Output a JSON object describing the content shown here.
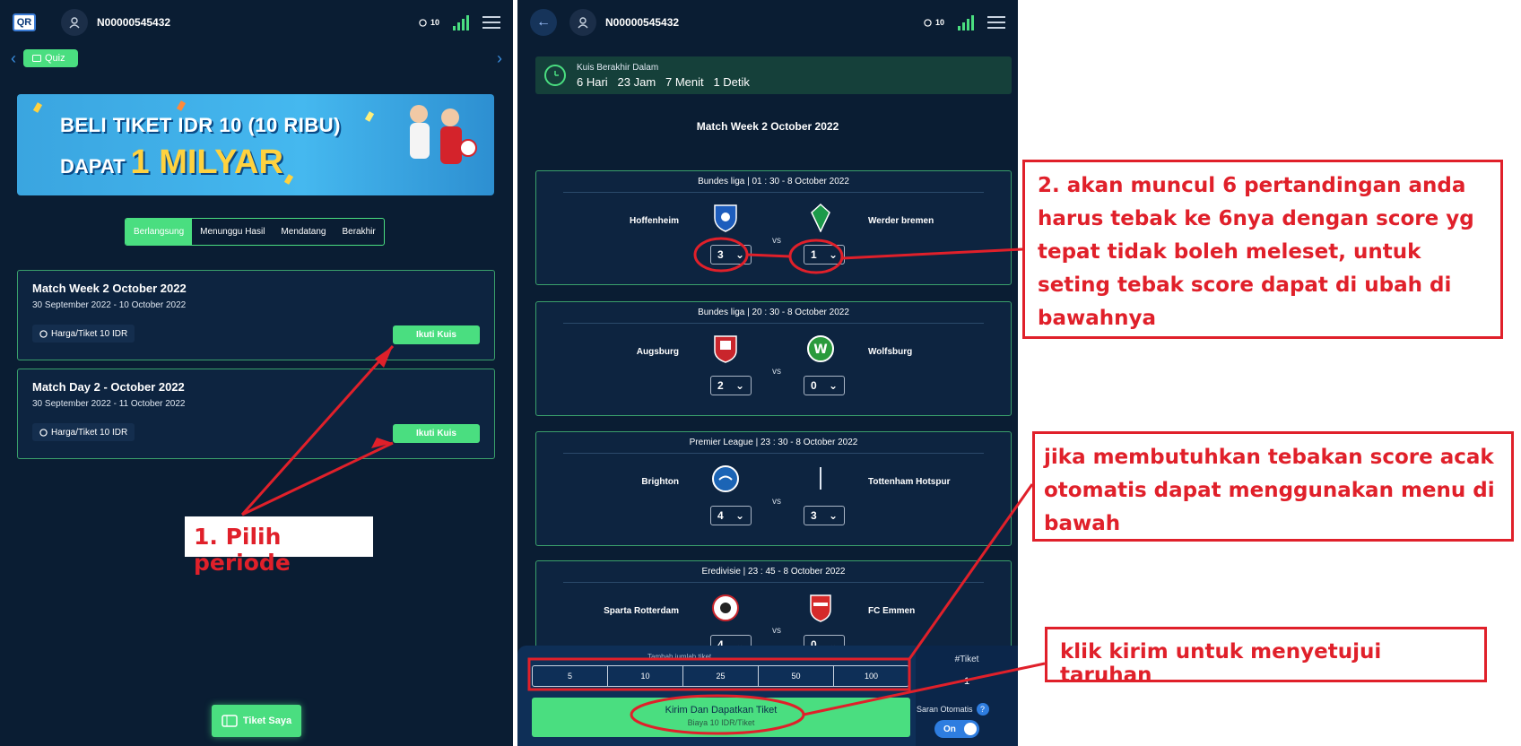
{
  "left_app": {
    "logo": "QR",
    "username": "N00000545432",
    "coins": "10",
    "quiz_tab": "Quiz",
    "banner": {
      "line1": "BELI TIKET IDR 10 (10 RIBU)",
      "line2_prefix": "DAPAT",
      "line2_big": "1 MILYAR"
    },
    "tabs": [
      "Berlangsung",
      "Menunggu Hasil",
      "Mendatang",
      "Berakhir"
    ],
    "periods": [
      {
        "title": "Match Week 2 October 2022",
        "dates": "30 September 2022 - 10 October 2022",
        "price": "Harga/Tiket 10 IDR",
        "button": "Ikuti Kuis"
      },
      {
        "title": "Match Day 2 - October 2022",
        "dates": "30 September 2022 - 11 October 2022",
        "price": "Harga/Tiket 10 IDR",
        "button": "Ikuti Kuis"
      }
    ],
    "ticket_button": "Tiket Saya"
  },
  "right_app": {
    "username": "N00000545432",
    "coins": "10",
    "countdown_label": "Kuis Berakhir Dalam",
    "countdown_value": "6 Hari   23 Jam   7 Menit   1 Detik",
    "week_title": "Match Week 2 October 2022",
    "vs": "vs",
    "matches": [
      {
        "header": "Bundes liga | 01 : 30 - 8 October 2022",
        "home": "Hoffenheim",
        "away": "Werder bremen",
        "home_score": "3",
        "away_score": "1"
      },
      {
        "header": "Bundes liga | 20 : 30 - 8 October 2022",
        "home": "Augsburg",
        "away": "Wolfsburg",
        "home_score": "2",
        "away_score": "0"
      },
      {
        "header": "Premier League | 23 : 30 - 8 October 2022",
        "home": "Brighton",
        "away": "Tottenham Hotspur",
        "home_score": "4",
        "away_score": "3"
      },
      {
        "header": "Eredivisie | 23 : 45 - 8 October 2022",
        "home": "Sparta Rotterdam",
        "away": "FC Emmen",
        "home_score": "4",
        "away_score": "0"
      }
    ],
    "qty_label": "Tambah jumlah tiket",
    "qty_options": [
      "5",
      "10",
      "25",
      "50",
      "100"
    ],
    "ticket_header": "#Tiket",
    "ticket_count": "1",
    "send_button": "Kirim Dan Dapatkan Tiket",
    "send_sub": "Biaya 10 IDR/Tiket",
    "auto_label": "Saran Otomatis",
    "help": "?",
    "toggle": "On"
  },
  "annotations": {
    "step1": "1. Pilih periode",
    "step2": "2. akan muncul 6 pertandingan anda harus tebak ke 6nya dengan score yg tepat tidak boleh meleset, untuk seting tebak score dapat di ubah di bawahnya",
    "step3": "jika membutuhkan tebakan score acak otomatis dapat menggunakan menu di bawah",
    "step4": "klik kirim untuk menyetujui taruhan",
    "color": "#e0202a"
  },
  "colors": {
    "background": "#0a1d33",
    "accent": "#4ade80",
    "card_border": "#3aa06b"
  }
}
